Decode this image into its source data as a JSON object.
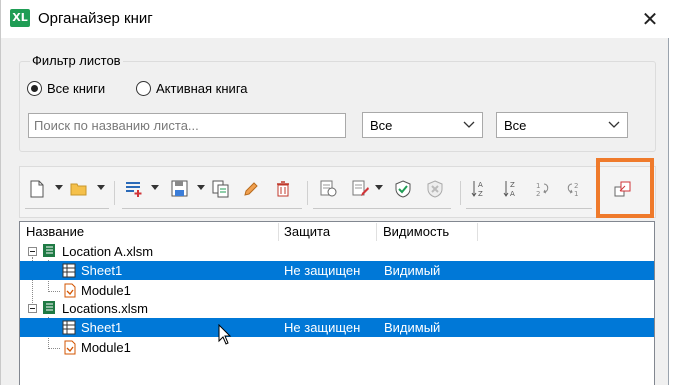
{
  "window": {
    "title": "Органайзер книг",
    "app_icon_text": "XL",
    "close_glyph": "✕"
  },
  "filter": {
    "group_label": "Фильтр листов",
    "radio_all": "Все книги",
    "radio_active": "Активная книга",
    "selected_radio": "all",
    "search_placeholder": "Поиск по названию листа...",
    "select1_value": "Все",
    "select2_value": "Все"
  },
  "toolbar": {
    "icons": [
      "new-file-icon",
      "open-folder-icon",
      "insert-sheet-icon",
      "save-icon",
      "copy-icon",
      "edit-pencil-icon",
      "delete-icon",
      "protect-view-icon",
      "protect-edit-icon",
      "shield-check-icon",
      "shield-cross-icon",
      "sort-az-icon",
      "sort-za-icon",
      "sort-custom-icon",
      "sort-reset-icon",
      "relocate-icon"
    ],
    "highlight_color": "#ef7a2b"
  },
  "tree": {
    "headers": {
      "name": "Название",
      "protection": "Защита",
      "visibility": "Видимость"
    },
    "books": [
      {
        "name": "Location A.xlsm",
        "children": [
          {
            "name": "Sheet1",
            "protection": "Не защищен",
            "visibility": "Видимый",
            "selected": true,
            "type": "sheet"
          },
          {
            "name": "Module1",
            "protection": "",
            "visibility": "",
            "selected": false,
            "type": "module"
          }
        ]
      },
      {
        "name": "Locations.xlsm",
        "children": [
          {
            "name": "Sheet1",
            "protection": "Не защищен",
            "visibility": "Видимый",
            "selected": true,
            "type": "sheet"
          },
          {
            "name": "Module1",
            "protection": "",
            "visibility": "",
            "selected": false,
            "type": "module"
          }
        ]
      }
    ],
    "selection_color": "#0078d7"
  }
}
